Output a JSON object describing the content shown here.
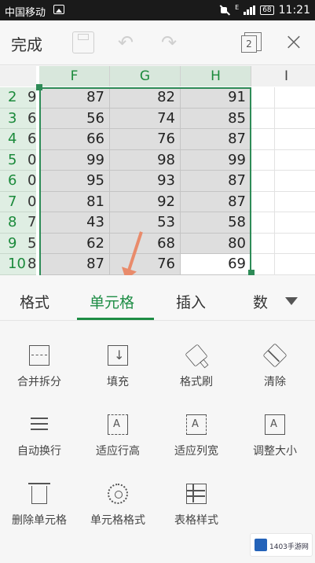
{
  "status_bar": {
    "carrier": "中国移动",
    "network": "E",
    "battery": "68",
    "time": "11:21"
  },
  "toolbar": {
    "done_label": "完成",
    "sheets_count": "2"
  },
  "sheet": {
    "columns": [
      "F",
      "G",
      "H",
      "I"
    ],
    "row_numbers": [
      "2",
      "3",
      "4",
      "5",
      "6",
      "7",
      "8",
      "9",
      "10"
    ],
    "row_clipped": [
      "9",
      "6",
      "6",
      "0",
      "0",
      "0",
      "7",
      "5",
      "8"
    ],
    "rows": [
      [
        "87",
        "82",
        "91"
      ],
      [
        "56",
        "74",
        "85"
      ],
      [
        "66",
        "76",
        "87"
      ],
      [
        "99",
        "98",
        "99"
      ],
      [
        "95",
        "93",
        "87"
      ],
      [
        "81",
        "92",
        "87"
      ],
      [
        "43",
        "53",
        "58"
      ],
      [
        "62",
        "68",
        "80"
      ],
      [
        "87",
        "76",
        "69"
      ]
    ],
    "selection_color": "#2e8b57"
  },
  "tabs": [
    {
      "label": "格式"
    },
    {
      "label": "单元格"
    },
    {
      "label": "插入"
    },
    {
      "label": "数"
    }
  ],
  "tools": [
    {
      "label": "合并拆分",
      "icon": "merge-split-icon"
    },
    {
      "label": "填充",
      "icon": "fill-icon"
    },
    {
      "label": "格式刷",
      "icon": "format-painter-icon"
    },
    {
      "label": "清除",
      "icon": "eraser-icon"
    },
    {
      "label": "自动换行",
      "icon": "wrap-text-icon"
    },
    {
      "label": "适应行高",
      "icon": "fit-row-height-icon"
    },
    {
      "label": "适应列宽",
      "icon": "fit-column-width-icon"
    },
    {
      "label": "调整大小",
      "icon": "resize-icon"
    },
    {
      "label": "删除单元格",
      "icon": "trash-icon"
    },
    {
      "label": "单元格格式",
      "icon": "gear-icon"
    },
    {
      "label": "表格样式",
      "icon": "table-style-icon"
    }
  ],
  "watermark": "1403手游网",
  "accent_color": "#1e8d45"
}
